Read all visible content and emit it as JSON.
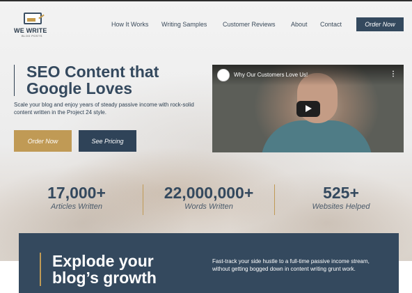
{
  "header": {
    "logo_title": "WE WRITE",
    "logo_subtitle": "BLOG POSTS",
    "nav": [
      "How It Works",
      "Writing Samples",
      "Customer Reviews",
      "About",
      "Contact"
    ],
    "order_button": "Order Now"
  },
  "hero": {
    "title": "SEO Content that Google Loves",
    "description": "Scale your blog and enjoy years of steady passive income with rock-solid content written in the Project 24 style.",
    "primary_button": "Order Now",
    "secondary_button": "See Pricing"
  },
  "video": {
    "title": "Why Our Customers Love Us!",
    "menu_icon": "more-vertical-icon",
    "play_icon": "play-icon"
  },
  "stats": [
    {
      "value": "17,000+",
      "label": "Articles Written"
    },
    {
      "value": "22,000,000+",
      "label": "Words Written"
    },
    {
      "value": "525+",
      "label": "Websites Helped"
    }
  ],
  "banner": {
    "title": "Explode your blog’s growth",
    "text": "Fast-track your side hustle to a full-time passive income stream, without getting bogged down in content writing grunt work."
  },
  "colors": {
    "navy": "#34495e",
    "gold": "#c09a55"
  }
}
